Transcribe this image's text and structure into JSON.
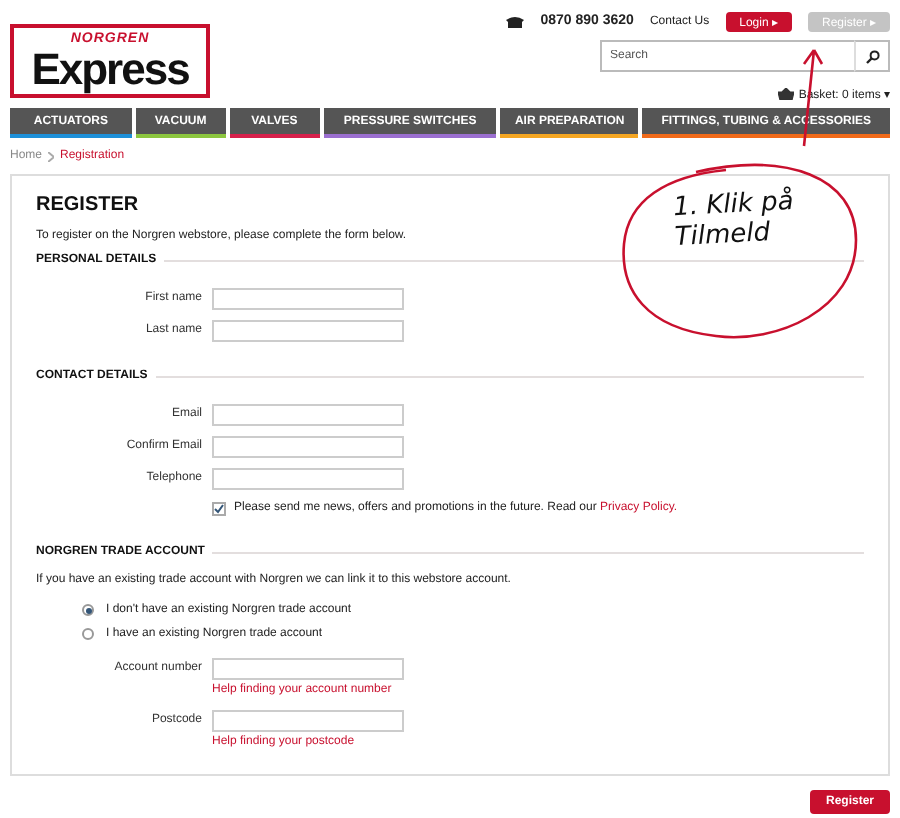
{
  "header": {
    "logo": {
      "brand": "NORGREN",
      "product": "Express"
    },
    "phone": "0870 890 3620",
    "contact_link": "Contact Us",
    "login_button": "Login ▸",
    "register_button": "Register ▸",
    "search": {
      "placeholder": "Search"
    },
    "basket": "Basket: 0 items ▾"
  },
  "nav": [
    {
      "label": "ACTUATORS",
      "color": "#1e90d8"
    },
    {
      "label": "VACUUM",
      "color": "#8cc63f"
    },
    {
      "label": "VALVES",
      "color": "#d6204b"
    },
    {
      "label": "PRESSURE SWITCHES",
      "color": "#9b6fd0"
    },
    {
      "label": "AIR PREPARATION",
      "color": "#f5a623"
    },
    {
      "label": "FITTINGS, TUBING & ACCESSORIES",
      "color": "#f06a1a"
    }
  ],
  "breadcrumb": [
    {
      "label": "Home",
      "current": false
    },
    {
      "label": "Registration",
      "current": true
    }
  ],
  "form": {
    "title": "REGISTER",
    "intro": "To register on the Norgren webstore, please complete the form below.",
    "sections": [
      {
        "heading": "PERSONAL DETAILS",
        "fields": [
          {
            "label": "First name"
          },
          {
            "label": "Last name"
          }
        ]
      },
      {
        "heading": "CONTACT DETAILS",
        "fields": [
          {
            "label": "Email"
          },
          {
            "label": "Confirm Email"
          },
          {
            "label": "Telephone"
          }
        ],
        "consent": {
          "text": "Please send me news, offers and promotions in the future. Read our",
          "link": "Privacy Policy.",
          "checked": true
        }
      },
      {
        "heading": "NORGREN TRADE ACCOUNT",
        "intro": "If you have an existing trade account with Norgren we can link it to this webstore account.",
        "options": [
          {
            "label": "I don't have an existing Norgren trade account",
            "selected": true
          },
          {
            "label": "I have an existing Norgren trade account",
            "selected": false
          }
        ],
        "fields": [
          {
            "label": "Account number",
            "help": "Help finding your account number"
          },
          {
            "label": "Postcode",
            "help": "Help finding your postcode"
          }
        ]
      }
    ],
    "submit": "Register"
  },
  "annotation": {
    "lines": [
      "1. Klik på",
      "Tilmeld"
    ]
  }
}
